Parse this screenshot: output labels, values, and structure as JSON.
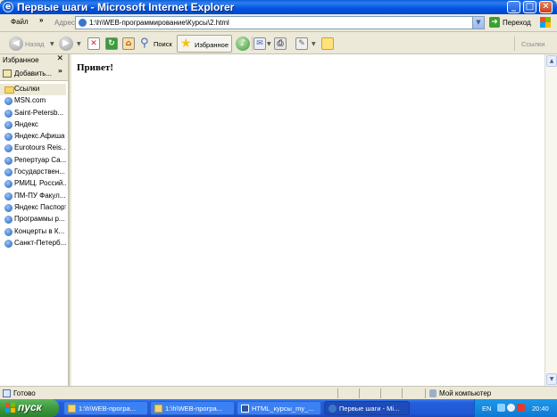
{
  "window": {
    "title": "Первые шаги - Microsoft Internet Explorer"
  },
  "menu": {
    "file_label": "Файл",
    "more": "»"
  },
  "address": {
    "label": "Адрес:",
    "value": "1:\\h\\WEB-программирование\\Курсы\\2.html",
    "go_label": "Переход"
  },
  "toolbar": {
    "back_label": "Назад",
    "search_label": "Поиск",
    "favorites_label": "Избранное",
    "links_label": "Ссылки"
  },
  "favorites_pane": {
    "title": "Избранное",
    "add_label": "Добавить...",
    "items": [
      {
        "label": "Ссылки",
        "icon": "folder-icon"
      },
      {
        "label": "MSN.com",
        "icon": "ie-page-icon"
      },
      {
        "label": "Saint-Petersb...",
        "icon": "ie-page-icon"
      },
      {
        "label": "Яндекс",
        "icon": "ie-page-icon"
      },
      {
        "label": "Яндекс.Афиша",
        "icon": "ie-page-icon"
      },
      {
        "label": "Eurotours Reis...",
        "icon": "ie-page-icon"
      },
      {
        "label": "Репертуар Са...",
        "icon": "ie-page-icon"
      },
      {
        "label": "Государствен...",
        "icon": "ie-page-icon"
      },
      {
        "label": "РМИЦ. Россий...",
        "icon": "ie-page-icon"
      },
      {
        "label": "ПМ-ПУ  Факул...",
        "icon": "ie-page-icon"
      },
      {
        "label": "Яндекс Паспорт",
        "icon": "ie-page-icon"
      },
      {
        "label": "Программы р...",
        "icon": "ie-page-icon"
      },
      {
        "label": "Концерты в К...",
        "icon": "ie-page-icon"
      },
      {
        "label": "Санкт-Петерб...",
        "icon": "ie-page-icon"
      }
    ]
  },
  "page": {
    "text": "Привет!"
  },
  "status": {
    "text": "Готово",
    "zone": "Мой компьютер"
  },
  "taskbar": {
    "start_label": "пуск",
    "tasks": [
      {
        "label": "1:\\h\\WEB-програ...",
        "icon": "folder-icon"
      },
      {
        "label": "1:\\h\\WEB-програ...",
        "icon": "folder-icon"
      },
      {
        "label": "HTML_курсы_my_...",
        "icon": "word-document-icon"
      },
      {
        "label": "Первые шаги - Mi...",
        "icon": "ie-page-icon"
      }
    ],
    "lang": "EN",
    "clock": "20:40"
  },
  "colors": {
    "title_bar": "#0054e3",
    "taskbar": "#245edb",
    "start_button": "#3c9a3c",
    "chrome": "#ece9d8"
  }
}
